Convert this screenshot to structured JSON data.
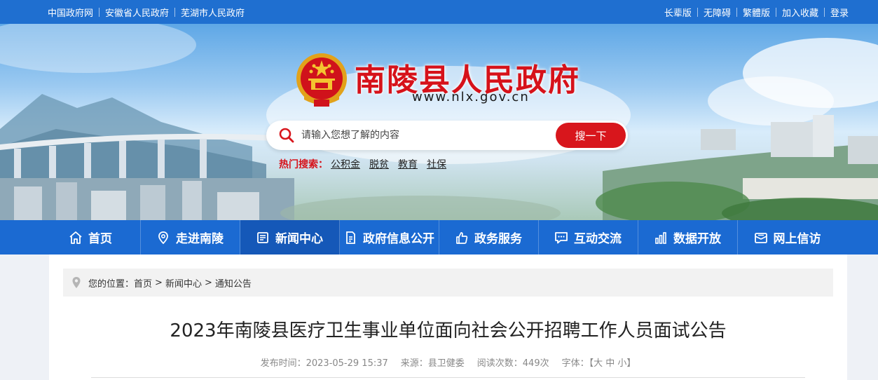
{
  "top_links": {
    "left": [
      "中国政府网",
      "安徽省人民政府",
      "芜湖市人民政府"
    ],
    "right": [
      "长辈版",
      "无障碍",
      "繁體版",
      "加入收藏",
      "登录"
    ]
  },
  "header": {
    "site_title": "南陵县人民政府",
    "site_url": "www.nlx.gov.cn"
  },
  "search": {
    "placeholder": "请输入您想了解的内容",
    "button_label": "搜一下",
    "hot_label": "热门搜索：",
    "hot_items": [
      "公积金",
      "脱贫",
      "教育",
      "社保"
    ]
  },
  "nav": {
    "items": [
      {
        "label": "首页",
        "icon": "home-icon"
      },
      {
        "label": "走进南陵",
        "icon": "location-pin-icon"
      },
      {
        "label": "新闻中心",
        "icon": "news-icon"
      },
      {
        "label": "政府信息公开",
        "icon": "document-icon"
      },
      {
        "label": "政务服务",
        "icon": "thumbs-up-icon"
      },
      {
        "label": "互动交流",
        "icon": "chat-icon"
      },
      {
        "label": "数据开放",
        "icon": "bar-chart-icon"
      },
      {
        "label": "网上信访",
        "icon": "mail-icon"
      }
    ],
    "active": "新闻中心"
  },
  "breadcrumb": {
    "prefix": "您的位置：",
    "items": [
      "首页",
      "新闻中心",
      "通知公告"
    ],
    "separator": ">"
  },
  "article": {
    "title": "2023年南陵县医疗卫生事业单位面向社会公开招聘工作人员面试公告",
    "publish_time": "发布时间：2023-05-29 15:37",
    "source": "来源：县卫健委",
    "views": "阅读次数：449次",
    "font_size": "字体：【大 中 小】"
  },
  "colors": {
    "topbar": "#1f6fd0",
    "nav": "#1b6ad2",
    "nav_active": "#1558b8",
    "brand_red": "#d6121a",
    "button_red": "#d8161c"
  }
}
